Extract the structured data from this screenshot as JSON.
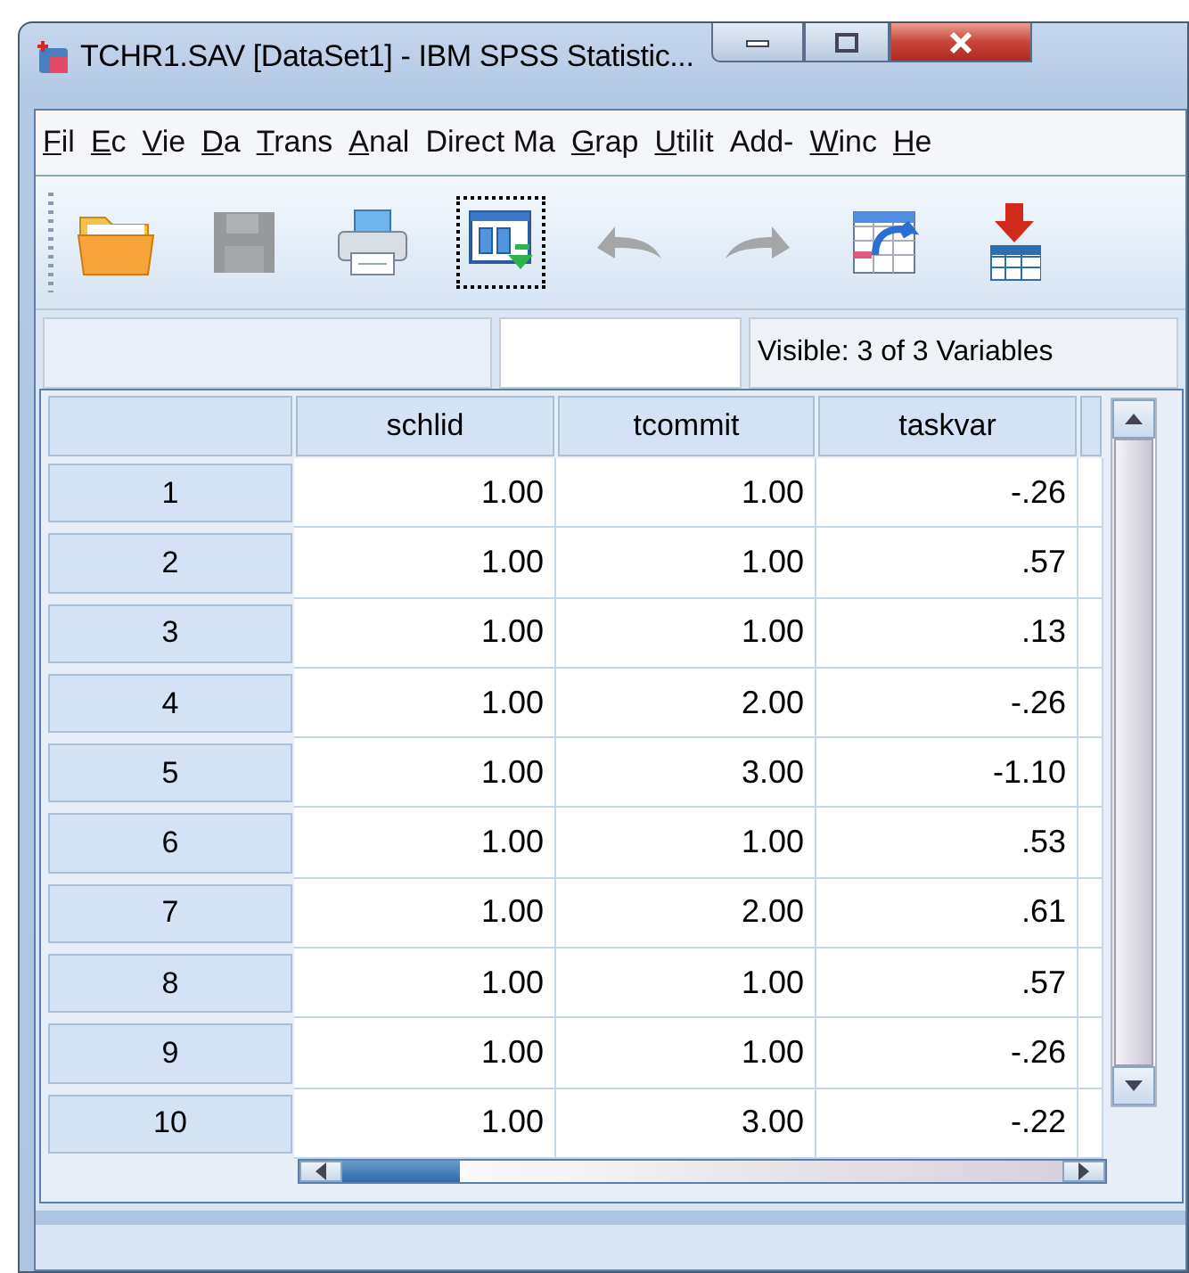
{
  "window": {
    "title": "TCHR1.SAV [DataSet1] - IBM SPSS Statistic..."
  },
  "menu": [
    {
      "label": "Fil",
      "underline_first": true
    },
    {
      "label": "Ec",
      "underline_first": true
    },
    {
      "label": "Vie",
      "underline_first": true
    },
    {
      "label": "Da",
      "underline_first": true
    },
    {
      "label": "Trans",
      "underline_first": true
    },
    {
      "label": "Anal",
      "underline_first": true
    },
    {
      "label": "Direct Ma",
      "underline_first": false
    },
    {
      "label": "Grap",
      "underline_first": true
    },
    {
      "label": "Utilit",
      "underline_first": true
    },
    {
      "label": "Add-",
      "underline_first": false
    },
    {
      "label": "Winc",
      "underline_first": true
    },
    {
      "label": "He",
      "underline_first": true
    }
  ],
  "toolbar": [
    {
      "kind": "open",
      "disabled": false,
      "selected": false
    },
    {
      "kind": "save",
      "disabled": true,
      "selected": false
    },
    {
      "kind": "print",
      "disabled": false,
      "selected": false
    },
    {
      "kind": "recall",
      "disabled": false,
      "selected": true
    },
    {
      "kind": "undo",
      "disabled": true,
      "selected": false
    },
    {
      "kind": "redo",
      "disabled": true,
      "selected": false
    },
    {
      "kind": "goto",
      "disabled": false,
      "selected": false
    },
    {
      "kind": "insert",
      "disabled": false,
      "selected": false
    }
  ],
  "info_bar": {
    "visible": "Visible: 3 of 3 Variables"
  },
  "table": {
    "columns": [
      "schlid",
      "tcommit",
      "taskvar"
    ],
    "rows": [
      {
        "number": "1",
        "cells": [
          "1.00",
          "1.00",
          "-.26"
        ]
      },
      {
        "number": "2",
        "cells": [
          "1.00",
          "1.00",
          ".57"
        ]
      },
      {
        "number": "3",
        "cells": [
          "1.00",
          "1.00",
          ".13"
        ]
      },
      {
        "number": "4",
        "cells": [
          "1.00",
          "2.00",
          "-.26"
        ]
      },
      {
        "number": "5",
        "cells": [
          "1.00",
          "3.00",
          "-1.10"
        ]
      },
      {
        "number": "6",
        "cells": [
          "1.00",
          "1.00",
          ".53"
        ]
      },
      {
        "number": "7",
        "cells": [
          "1.00",
          "2.00",
          ".61"
        ]
      },
      {
        "number": "8",
        "cells": [
          "1.00",
          "1.00",
          ".57"
        ]
      },
      {
        "number": "9",
        "cells": [
          "1.00",
          "1.00",
          "-.26"
        ]
      },
      {
        "number": "10",
        "cells": [
          "1.00",
          "3.00",
          "-.22"
        ]
      }
    ]
  }
}
